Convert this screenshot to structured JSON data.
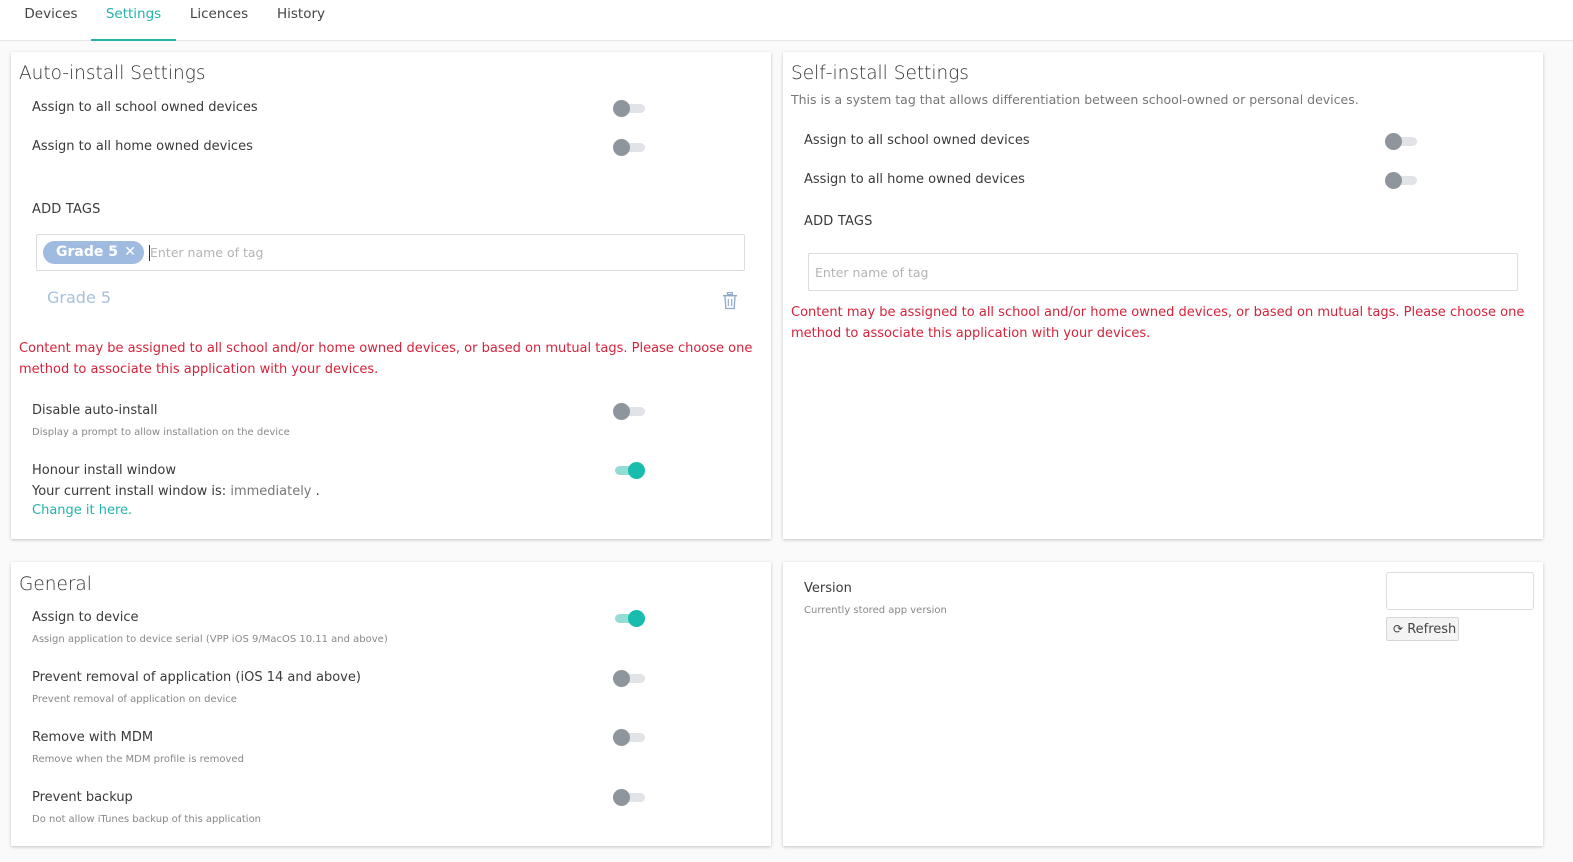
{
  "tabs": [
    "Devices",
    "Settings",
    "Licences",
    "History"
  ],
  "auto_install": {
    "title": "Auto-install Settings",
    "school_label": "Assign to all school owned devices",
    "home_label": "Assign to all home owned devices",
    "school_on": false,
    "home_on": false,
    "add_tags_label": "ADD TAGS",
    "tag_chip": "Grade 5",
    "tag_placeholder": "Enter name of tag",
    "tag_list_item": "Grade 5",
    "warning": "Content may be assigned to all school and/or home owned devices, or based on mutual tags. Please choose one method to associate this application with your devices.",
    "disable_label": "Disable auto-install",
    "disable_hint": "Display a prompt to allow installation on the device",
    "disable_on": false,
    "honour_label": "Honour install window",
    "honour_on": true,
    "window_prefix": "Your current install window is:",
    "window_value": "immediately",
    "window_suffix": ".",
    "change_link": "Change it here."
  },
  "self_install": {
    "title": "Self-install Settings",
    "subtitle": "This is a system tag that allows differentiation between school-owned or personal devices.",
    "school_label": "Assign to all school owned devices",
    "home_label": "Assign to all home owned devices",
    "school_on": false,
    "home_on": false,
    "add_tags_label": "ADD TAGS",
    "tag_placeholder": "Enter name of tag",
    "warning": "Content may be assigned to all school and/or home owned devices, or based on mutual tags. Please choose one method to associate this application with your devices."
  },
  "general": {
    "title": "General",
    "rows": [
      {
        "label": "Assign to device",
        "hint": "Assign application to device serial (VPP iOS 9/MacOS 10.11 and above)",
        "on": true
      },
      {
        "label": "Prevent removal of application (iOS 14 and above)",
        "hint": "Prevent removal of application on device",
        "on": false
      },
      {
        "label": "Remove with MDM",
        "hint": "Remove when the MDM profile is removed",
        "on": false
      },
      {
        "label": "Prevent backup",
        "hint": "Do not allow iTunes backup of this application",
        "on": false
      }
    ]
  },
  "version": {
    "label": "Version",
    "hint": "Currently stored app version",
    "value": "",
    "refresh_label": "Refresh"
  },
  "colors": {
    "accent": "#22b3a9",
    "warning": "#d4233b",
    "chip": "#9fbce0"
  }
}
